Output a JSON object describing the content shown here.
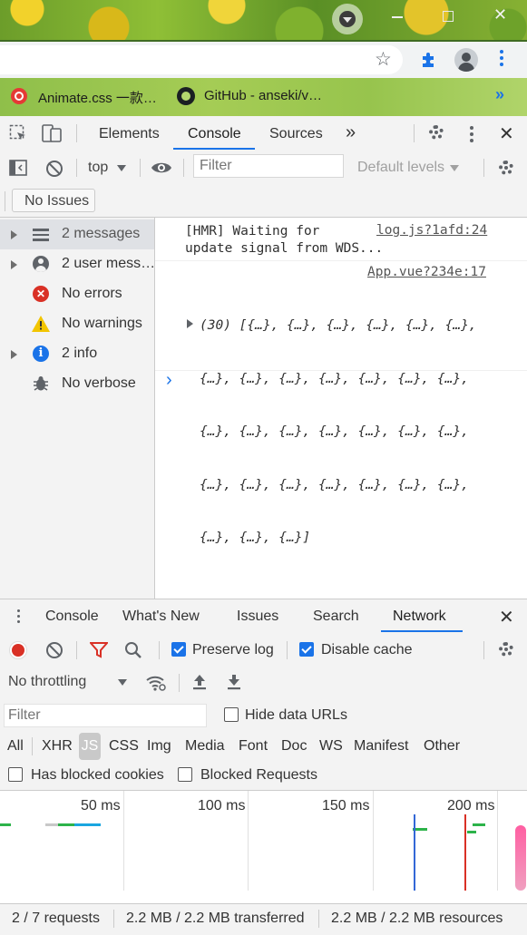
{
  "bookmarks": [
    {
      "label": "Animate.css 一款…",
      "icon": "animate-css-icon"
    },
    {
      "label": "GitHub - anseki/v…",
      "icon": "github-icon"
    }
  ],
  "bookmarks_overflow": "»",
  "devtools": {
    "tabs": [
      "Elements",
      "Console",
      "Sources"
    ],
    "active_tab": "Console",
    "more_tabs": "»"
  },
  "console_toolbar": {
    "context": "top",
    "filter_placeholder": "Filter",
    "levels": "Default levels"
  },
  "issues_button": "No Issues",
  "sidebar": [
    {
      "label": "2 messages",
      "icon": "list-icon",
      "expandable": true,
      "selected": true
    },
    {
      "label": "2 user mess…",
      "icon": "user-icon",
      "expandable": true
    },
    {
      "label": "No errors",
      "icon": "error-icon",
      "expandable": false
    },
    {
      "label": "No warnings",
      "icon": "warning-icon",
      "expandable": false
    },
    {
      "label": "2 info",
      "icon": "info-icon",
      "expandable": true
    },
    {
      "label": "No verbose",
      "icon": "bug-icon",
      "expandable": false
    }
  ],
  "console_messages": [
    {
      "text_line1": "[HMR] Waiting for",
      "text_line2": "update signal from WDS...",
      "source": "log.js?1afd:24"
    },
    {
      "source": "App.vue?234e:17",
      "lines": [
        "(30) [{…}, {…}, {…}, {…}, {…}, {…},",
        "{…}, {…}, {…}, {…}, {…}, {…}, {…},",
        "{…}, {…}, {…}, {…}, {…}, {…}, {…},",
        "{…}, {…}, {…}, {…}, {…}, {…}, {…},",
        "{…}, {…}, {…}]"
      ]
    }
  ],
  "prompt": "›",
  "drawer": {
    "tabs": [
      "Console",
      "What's New",
      "Issues",
      "Search",
      "Network"
    ],
    "active_tab": "Network"
  },
  "network": {
    "preserve_log": "Preserve log",
    "disable_cache": "Disable cache",
    "throttling": "No throttling",
    "filter_placeholder": "Filter",
    "hide_data_urls": "Hide data URLs",
    "types": [
      "All",
      "XHR",
      "JS",
      "CSS",
      "Img",
      "Media",
      "Font",
      "Doc",
      "WS",
      "Manifest",
      "Other"
    ],
    "active_type": "JS",
    "has_blocked_cookies": "Has blocked cookies",
    "blocked_requests": "Blocked Requests",
    "timeline_ticks": [
      "50 ms",
      "100 ms",
      "150 ms",
      "200 ms"
    ]
  },
  "status": {
    "requests": "2 / 7 requests",
    "transferred": "2.2 MB / 2.2 MB transferred",
    "resources": "2.2 MB / 2.2 MB resources"
  },
  "colors": {
    "accent": "#1a73e8",
    "error": "#d93025",
    "warning": "#f2c500",
    "info": "#1a73e8"
  }
}
